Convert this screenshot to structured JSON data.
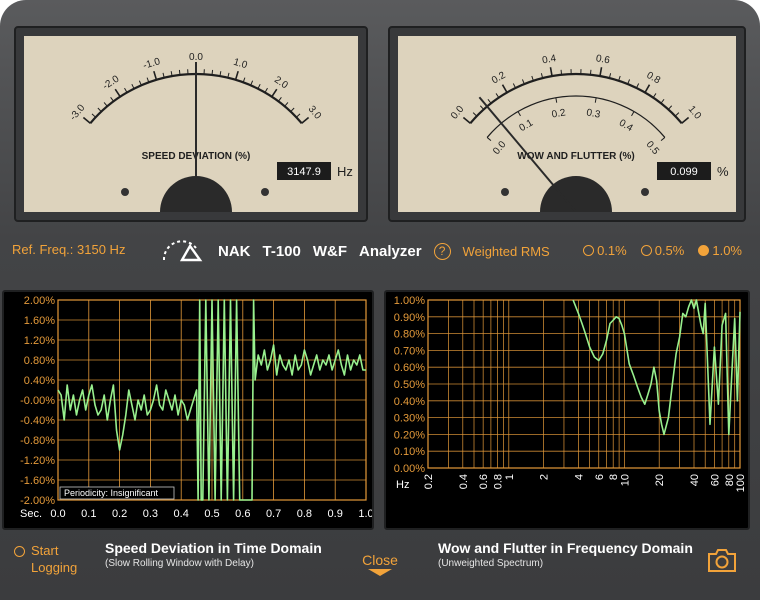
{
  "meters": {
    "speed": {
      "title": "SPEED DEVIATION (%)",
      "scale": [
        "-3.0",
        "-2.0",
        "-1.0",
        "0.0",
        "1.0",
        "2.0",
        "3.0"
      ],
      "reading": "3147.9",
      "unit": "Hz",
      "needle_value": 0.0
    },
    "wow": {
      "title": "WOW AND FLUTTER (%)",
      "scale_outer": [
        "0.0",
        "0.2",
        "0.4",
        "0.6",
        "0.8",
        "1.0"
      ],
      "scale_inner": [
        "0.0",
        "0.1",
        "0.2",
        "0.3",
        "0.4",
        "0.5"
      ],
      "reading": "0.099",
      "unit": "%",
      "needle_value": 0.099
    }
  },
  "controls": {
    "ref_freq": "Ref. Freq.: 3150 Hz",
    "brand": [
      "NAK",
      "T-100",
      "W&F",
      "Analyzer"
    ],
    "help": "?",
    "weighting": "Weighted RMS",
    "ranges": [
      {
        "label": "0.1%",
        "selected": false
      },
      {
        "label": "0.5%",
        "selected": false
      },
      {
        "label": "1.0%",
        "selected": true
      }
    ]
  },
  "chart_data": [
    {
      "type": "line",
      "title": "Speed Deviation in Time Domain",
      "subtitle": "(Slow Rolling Window with Delay)",
      "xlabel": "Sec.",
      "x_ticks": [
        "0.0",
        "0.1",
        "0.2",
        "0.3",
        "0.4",
        "0.5",
        "0.6",
        "0.7",
        "0.8",
        "0.9",
        "1.0"
      ],
      "y_ticks": [
        "2.00%",
        "1.60%",
        "1.20%",
        "0.80%",
        "0.40%",
        "-0.00%",
        "-0.40%",
        "-0.80%",
        "-1.20%",
        "-1.60%",
        "-2.00%"
      ],
      "xlim": [
        0,
        1.0
      ],
      "ylim": [
        -2.0,
        2.0
      ],
      "annotation": "Periodicity: Insignificant",
      "grid": true,
      "color": "#98f08e",
      "series": [
        {
          "x": [
            0.0,
            0.01,
            0.02,
            0.03,
            0.04,
            0.05,
            0.06,
            0.07,
            0.08,
            0.09,
            0.1,
            0.11,
            0.12,
            0.13,
            0.14,
            0.15,
            0.16,
            0.17,
            0.18,
            0.19,
            0.2,
            0.21,
            0.22,
            0.23,
            0.24,
            0.25,
            0.26,
            0.27,
            0.28,
            0.29,
            0.3,
            0.31,
            0.32,
            0.33,
            0.34,
            0.35,
            0.36,
            0.37,
            0.38,
            0.39,
            0.4,
            0.41,
            0.42,
            0.43,
            0.44,
            0.45,
            0.455,
            0.46,
            0.465,
            0.47,
            0.48,
            0.49,
            0.5,
            0.51,
            0.52,
            0.53,
            0.54,
            0.55,
            0.56,
            0.57,
            0.58,
            0.59,
            0.6,
            0.61,
            0.62,
            0.63,
            0.635,
            0.64,
            0.65,
            0.66,
            0.67,
            0.68,
            0.69,
            0.7,
            0.71,
            0.72,
            0.73,
            0.74,
            0.75,
            0.76,
            0.77,
            0.78,
            0.79,
            0.8,
            0.81,
            0.82,
            0.83,
            0.84,
            0.85,
            0.86,
            0.87,
            0.88,
            0.89,
            0.9,
            0.91,
            0.92,
            0.93,
            0.94,
            0.95,
            0.96,
            0.97,
            0.98,
            0.99,
            1.0
          ],
          "y": [
            0.2,
            0.1,
            -0.4,
            0.3,
            -0.2,
            0.1,
            -0.3,
            0.0,
            0.2,
            -0.2,
            0.1,
            0.3,
            -0.1,
            -0.3,
            -0.2,
            0.1,
            -0.4,
            0.0,
            0.3,
            -0.6,
            -1.0,
            -0.7,
            -0.3,
            0.2,
            -0.1,
            -0.4,
            0.0,
            -0.2,
            0.1,
            -0.3,
            -0.2,
            0.0,
            0.3,
            -0.1,
            -0.2,
            0.2,
            0.0,
            -0.2,
            0.1,
            -0.3,
            0.0,
            -0.1,
            -0.4,
            -0.2,
            0.0,
            0.2,
            -2.0,
            2.0,
            -2.0,
            -2.0,
            2.0,
            -2.0,
            2.0,
            -2.0,
            2.0,
            -2.0,
            2.0,
            -2.0,
            2.0,
            -2.0,
            2.0,
            -2.0,
            -2.0,
            -2.0,
            -2.0,
            -2.0,
            2.0,
            0.4,
            0.9,
            0.7,
            1.0,
            0.6,
            0.8,
            1.1,
            0.5,
            0.9,
            0.7,
            0.6,
            0.8,
            0.5,
            0.9,
            0.6,
            0.7,
            1.0,
            0.8,
            0.5,
            0.7,
            0.9,
            0.6,
            0.8,
            0.7,
            0.9,
            0.6,
            0.8,
            1.0,
            0.7,
            0.5,
            0.9,
            0.6,
            0.8,
            0.7,
            0.9,
            0.6,
            0.6
          ]
        }
      ]
    },
    {
      "type": "line",
      "title": "Wow and Flutter in Frequency Domain",
      "subtitle": "(Unweighted Spectrum)",
      "xlabel": "Hz",
      "x_scale": "log",
      "x_ticks": [
        "0.2",
        "0.4",
        "0.6",
        "0.8",
        "1",
        "2",
        "4",
        "6",
        "8",
        "10",
        "20",
        "40",
        "60",
        "80",
        "100"
      ],
      "y_ticks": [
        "1.00%",
        "0.90%",
        "0.80%",
        "0.70%",
        "0.60%",
        "0.50%",
        "0.40%",
        "0.30%",
        "0.20%",
        "0.10%",
        "0.00%"
      ],
      "xlim": [
        0.2,
        100
      ],
      "ylim": [
        0,
        1.0
      ],
      "grid": true,
      "color": "#98f08e",
      "series": [
        {
          "x": [
            3.6,
            4.0,
            4.3,
            4.6,
            5.0,
            5.5,
            6.0,
            6.5,
            7.0,
            7.5,
            8.0,
            8.5,
            9.0,
            9.5,
            10.0,
            11,
            12,
            13,
            14,
            15,
            16,
            17,
            18,
            19,
            20,
            21,
            22,
            24,
            26,
            28,
            30,
            32,
            34,
            36,
            38,
            40,
            42,
            44,
            46,
            48,
            50,
            55,
            60,
            65,
            70,
            75,
            80,
            85,
            90,
            95,
            100
          ],
          "y": [
            1.0,
            0.92,
            0.86,
            0.8,
            0.72,
            0.66,
            0.64,
            0.68,
            0.76,
            0.86,
            0.88,
            0.9,
            0.89,
            0.85,
            0.8,
            0.62,
            0.55,
            0.48,
            0.42,
            0.38,
            0.44,
            0.5,
            0.6,
            0.52,
            0.34,
            0.26,
            0.2,
            0.3,
            0.5,
            0.68,
            0.78,
            0.92,
            0.9,
            0.96,
            1.0,
            0.95,
            1.0,
            0.92,
            0.85,
            0.8,
            0.98,
            0.26,
            0.72,
            0.38,
            0.85,
            0.92,
            0.2,
            0.56,
            0.89,
            0.4,
            0.93
          ]
        }
      ]
    }
  ],
  "bottom": {
    "start_logging": [
      "Start",
      "Logging"
    ],
    "left_caption": "Speed Deviation in Time Domain",
    "left_sub": "(Slow Rolling Window with Delay)",
    "close": "Close",
    "right_caption": "Wow and Flutter in Frequency Domain",
    "right_sub": "(Unweighted Spectrum)"
  },
  "icons": {
    "logo": "tape-reel-logo-icon",
    "camera": "camera-icon"
  },
  "colors": {
    "accent": "#f2a33a",
    "trace": "#98f08e",
    "meter_face": "#ddd3bd"
  }
}
